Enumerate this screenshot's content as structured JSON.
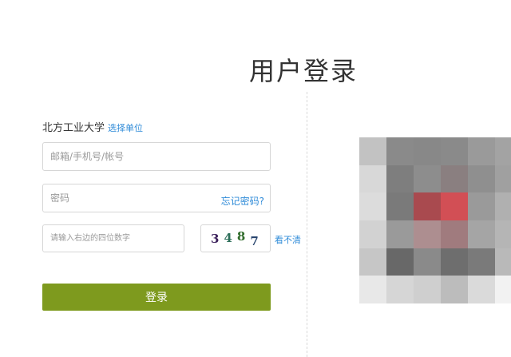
{
  "page": {
    "title": "用户登录"
  },
  "form": {
    "org_name": "北方工业大学",
    "org_select_link": "选择单位",
    "account_placeholder": "邮箱/手机号/帐号",
    "password_placeholder": "密码",
    "forgot_password": "忘记密码?",
    "captcha_placeholder": "请输入右边的四位数字",
    "captcha_digits": [
      "3",
      "4",
      "8",
      "7"
    ],
    "captcha_refresh": "看不清",
    "login_label": "登录"
  },
  "colors": {
    "accent_button": "#7e9a1e",
    "link": "#2f8bd8"
  },
  "qr_code": {
    "state": "pixelated",
    "cell_colors": [
      [
        "#c2c2c2",
        "#8a8a8a",
        "#888888",
        "#8a8a8a",
        "#9a9a9a",
        "#a3a3a3"
      ],
      [
        "#d8d8d8",
        "#7e7e7e",
        "#8d8d8d",
        "#8a7f80",
        "#8f8f8f",
        "#a0a0a0"
      ],
      [
        "#dcdcdc",
        "#7a7a7a",
        "#a94a4f",
        "#d24f55",
        "#9a9a9a",
        "#b0b0b0"
      ],
      [
        "#d2d2d2",
        "#9a9a9a",
        "#ad8e90",
        "#a07b7e",
        "#a5a5a5",
        "#b5b5b5"
      ],
      [
        "#c6c6c6",
        "#686868",
        "#8a8a8a",
        "#6e6e6e",
        "#7a7a7a",
        "#b9b9b9"
      ],
      [
        "#e8e8e8",
        "#d6d6d6",
        "#cfcfcf",
        "#bcbcbc",
        "#dadada",
        "#f2f2f2"
      ]
    ]
  }
}
